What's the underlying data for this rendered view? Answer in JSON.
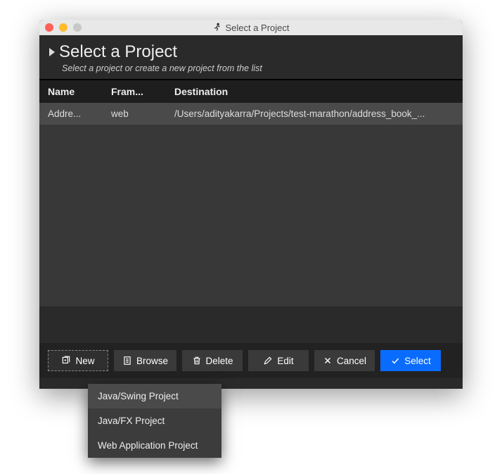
{
  "titlebar": {
    "title": "Select a Project"
  },
  "header": {
    "title": "Select a Project",
    "subtitle": "Select a project or create a new project from the list"
  },
  "table": {
    "headers": {
      "name": "Name",
      "framework": "Fram...",
      "destination": "Destination"
    },
    "rows": [
      {
        "name": "Addre...",
        "framework": "web",
        "destination": "/Users/adityakarra/Projects/test-marathon/address_book_..."
      }
    ]
  },
  "buttons": {
    "new": "New",
    "browse": "Browse",
    "delete": "Delete",
    "edit": "Edit",
    "cancel": "Cancel",
    "select": "Select"
  },
  "dropdown": {
    "items": [
      "Java/Swing Project",
      "Java/FX Project",
      "Web Application Project"
    ]
  }
}
